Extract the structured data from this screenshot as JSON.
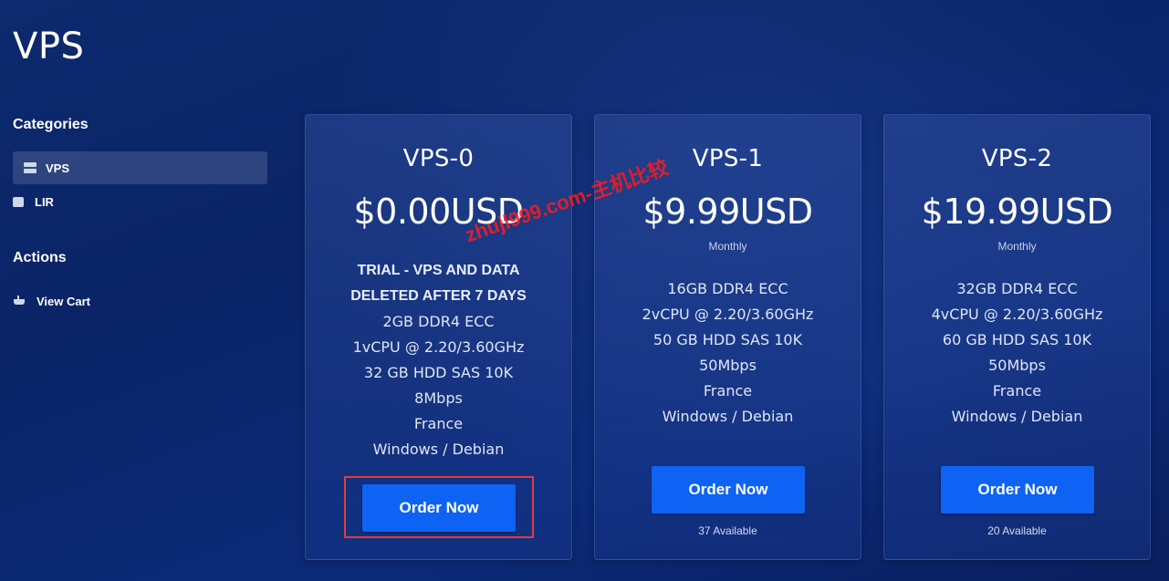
{
  "page": {
    "title": "VPS"
  },
  "sidebar": {
    "categories_heading": "Categories",
    "categories": [
      {
        "label": "VPS",
        "icon": "server-icon",
        "active": true
      },
      {
        "label": "LIR",
        "icon": "box-icon",
        "active": false
      }
    ],
    "actions_heading": "Actions",
    "actions": [
      {
        "label": "View Cart",
        "icon": "cart-icon"
      }
    ]
  },
  "products": [
    {
      "name": "VPS-0",
      "price": "$0.00USD",
      "cycle": "",
      "features": [
        "TRIAL - VPS AND DATA",
        "DELETED AFTER 7 DAYS",
        "2GB DDR4 ECC",
        "1vCPU @ 2.20/3.60GHz",
        "32 GB HDD SAS 10K",
        "8Mbps",
        "France",
        "Windows / Debian"
      ],
      "order_label": "Order Now",
      "available": ""
    },
    {
      "name": "VPS-1",
      "price": "$9.99USD",
      "cycle": "Monthly",
      "features": [
        "16GB DDR4 ECC",
        "2vCPU @ 2.20/3.60GHz",
        "50 GB HDD SAS 10K",
        "50Mbps",
        "France",
        "Windows / Debian"
      ],
      "order_label": "Order Now",
      "available": "37 Available"
    },
    {
      "name": "VPS-2",
      "price": "$19.99USD",
      "cycle": "Monthly",
      "features": [
        "32GB DDR4 ECC",
        "4vCPU @ 2.20/3.60GHz",
        "60 GB HDD SAS 10K",
        "50Mbps",
        "France",
        "Windows / Debian"
      ],
      "order_label": "Order Now",
      "available": "20 Available"
    }
  ],
  "watermark": "zhujl999.com-主机比较",
  "colors": {
    "background": "#0a2467",
    "button": "#0e63f4",
    "highlight": "#e23b3b",
    "watermark": "#ff1a1a"
  }
}
